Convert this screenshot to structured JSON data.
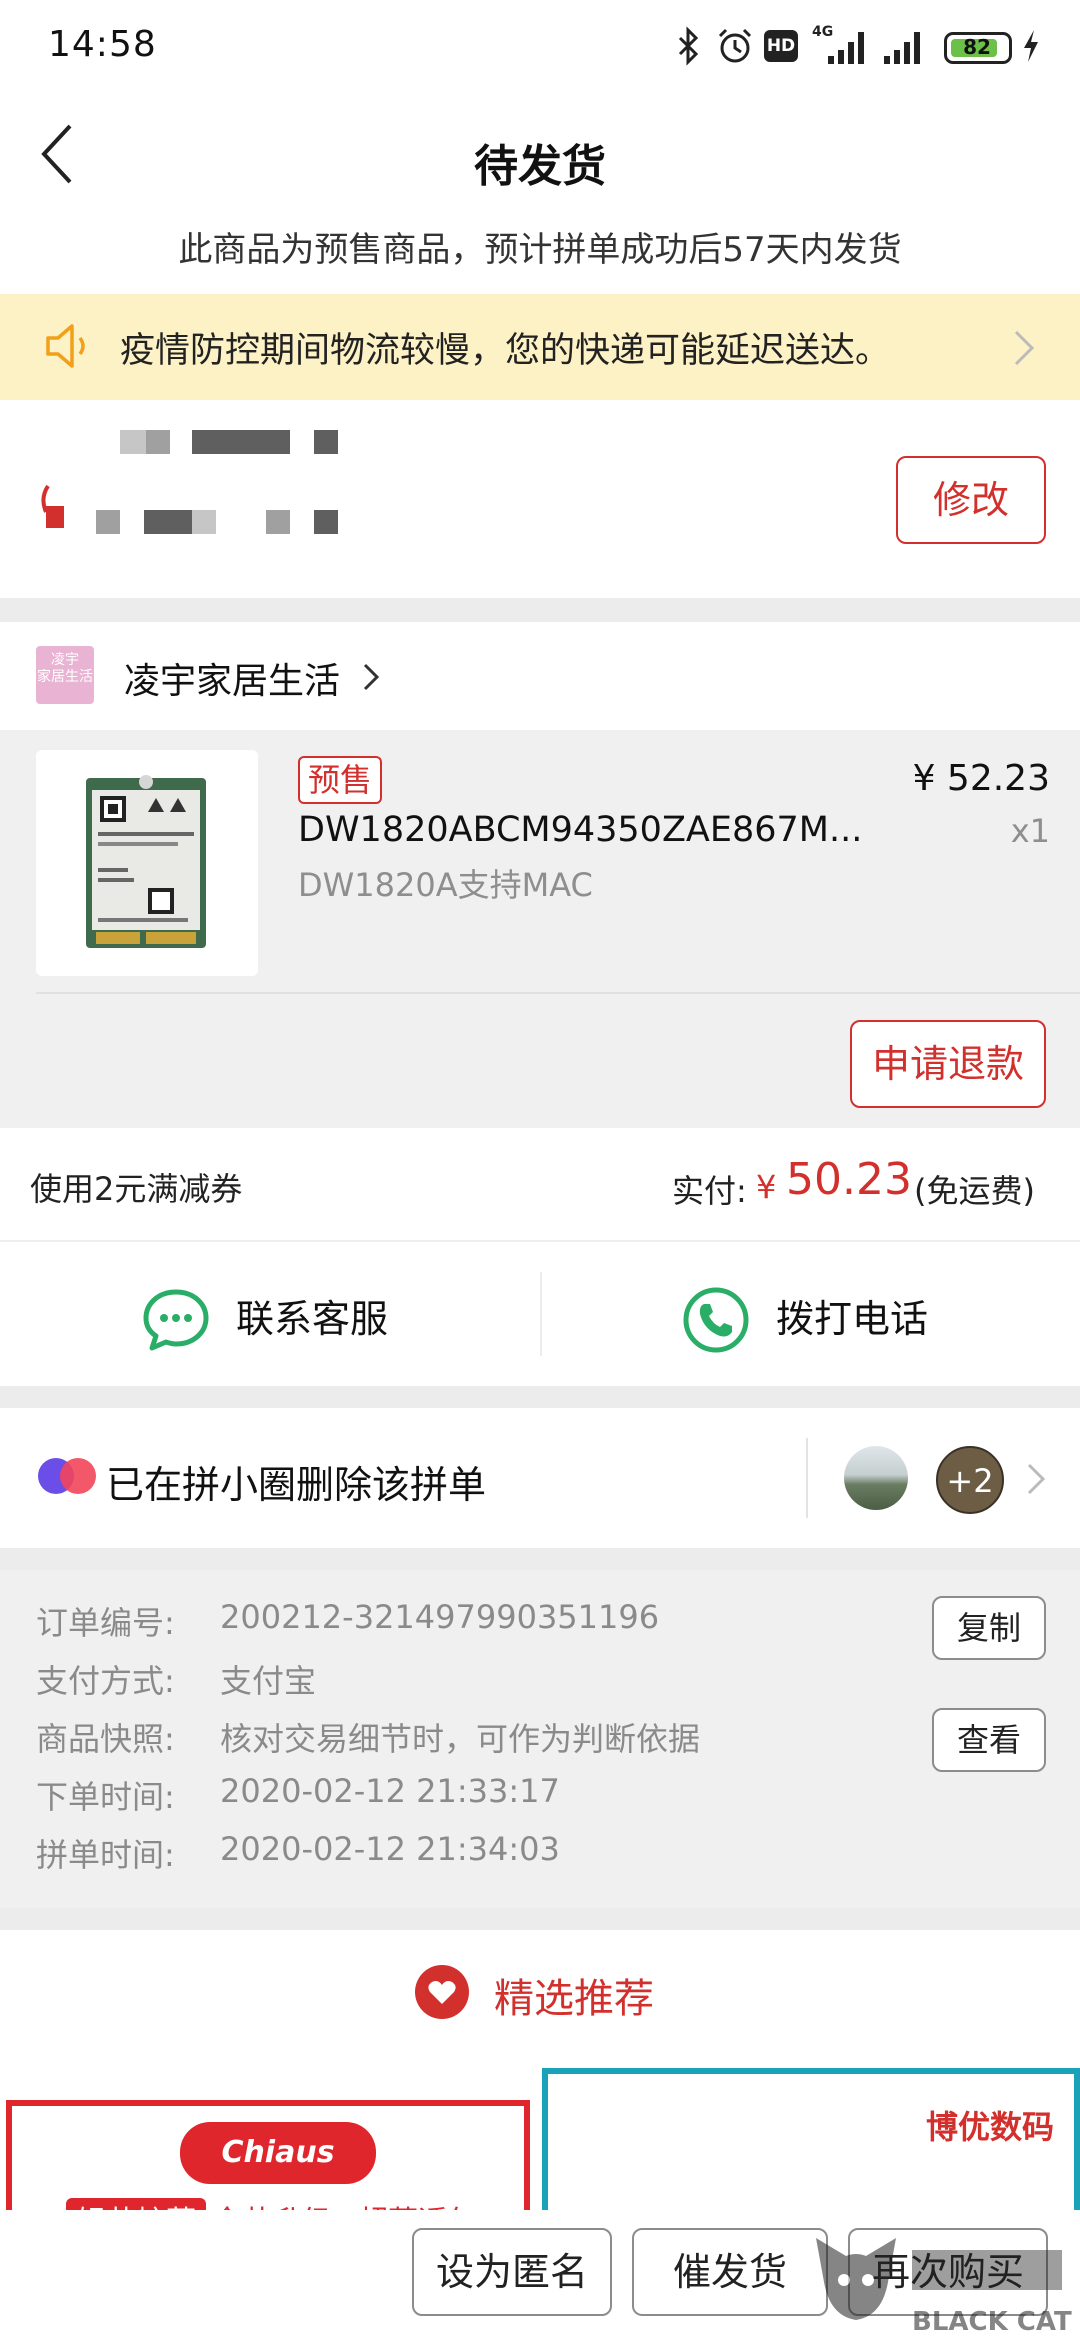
{
  "status_bar": {
    "time": "14:58",
    "network": "4G",
    "hd": "HD",
    "battery_percent": 82,
    "battery_label": "82",
    "icons": [
      "bluetooth-icon",
      "alarm-icon",
      "hd-icon",
      "signal-icon",
      "wifi-signal-icon",
      "battery-icon",
      "charging-icon"
    ]
  },
  "header": {
    "title": "待发货",
    "subtitle": "此商品为预售商品，预计拼单成功后57天内发货"
  },
  "notice": {
    "text": "疫情防控期间物流较慢，您的快递可能延迟送达。"
  },
  "address": {
    "edit_label": "修改"
  },
  "store": {
    "logo_text": "凌宇\n家居生活",
    "name": "凌宇家居生活"
  },
  "product": {
    "tag": "预售",
    "title": "DW1820ABCM94350ZAE867M...",
    "spec": "DW1820A支持MAC",
    "price": "¥ 52.23",
    "quantity": "x1",
    "refund_label": "申请退款"
  },
  "payment": {
    "coupon": "使用2元满减券",
    "paid_label": "实付:",
    "currency": "¥",
    "amount": "50.23",
    "shipping_note": "(免运费)"
  },
  "contact": {
    "service_label": "联系客服",
    "phone_label": "拨打电话"
  },
  "circle": {
    "text": "已在拼小圈删除该拼单",
    "more_count": "+2"
  },
  "order_info": {
    "order_no_label": "订单编号:",
    "order_no": "200212-321497990351196",
    "copy_label": "复制",
    "payment_method_label": "支付方式:",
    "payment_method": "支付宝",
    "snapshot_label": "商品快照:",
    "snapshot_text": "核对交易细节时，可作为判断依据",
    "view_label": "查看",
    "order_time_label": "下单时间:",
    "order_time": "2020-02-12 21:33:17",
    "group_time_label": "拼单时间:",
    "group_time": "2020-02-12 21:34:03"
  },
  "recommend": {
    "title": "精选推荐",
    "left_card": {
      "badge": "Chiaus",
      "tag1": "轻芯炫薄",
      "tag2": "全芯升级",
      "tag3": "超薄透气"
    },
    "right_card": {
      "brand": "博优数码"
    }
  },
  "bottom_bar": {
    "anonymous_label": "设为匿名",
    "urge_label": "催发货",
    "rebuy_label": "再次购买"
  },
  "watermark": {
    "text": "BLACK CAT"
  },
  "colors": {
    "accent_red": "#d2302c",
    "notice_bg": "#fdf1c6",
    "wechat_green": "#2aae67",
    "battery_green": "#6cc04a",
    "card_teal": "#1aa3b8"
  }
}
